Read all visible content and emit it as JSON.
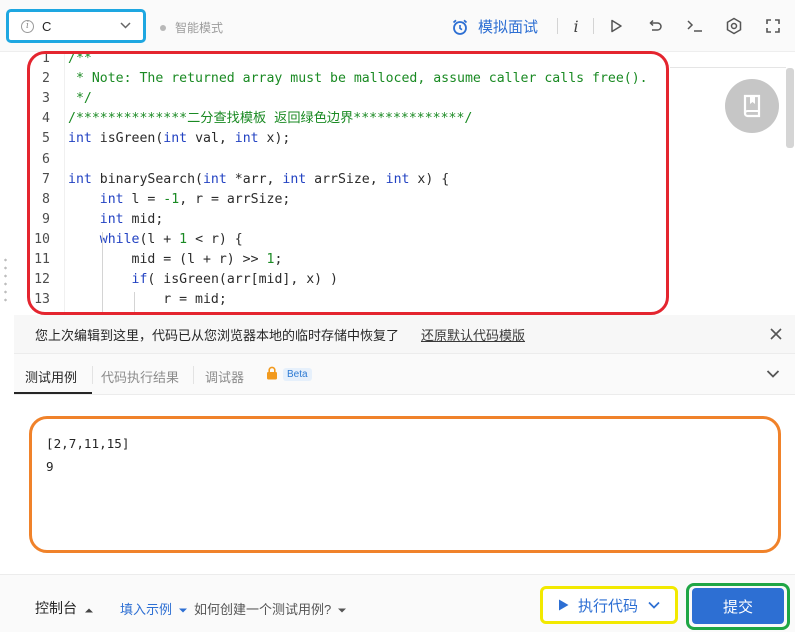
{
  "toolbar": {
    "language": "C",
    "smart_mode": "智能模式",
    "mock_interview": "模拟面试",
    "icons": [
      "info-icon",
      "run-triangle-icon",
      "reset-icon",
      "terminal-icon",
      "settings-icon",
      "fullscreen-icon"
    ]
  },
  "editor": {
    "lines": [
      {
        "n": "1",
        "text": "/**"
      },
      {
        "n": "2",
        "text": " * Note: The returned array must be malloced, assume caller calls free()."
      },
      {
        "n": "3",
        "text": " */"
      },
      {
        "n": "4",
        "text": "/**************二分查找模板 返回绿色边界**************/"
      },
      {
        "n": "5",
        "text": "int isGreen(int val, int x);"
      },
      {
        "n": "6",
        "text": ""
      },
      {
        "n": "7",
        "text": "int binarySearch(int *arr, int arrSize, int x) {"
      },
      {
        "n": "8",
        "text": "    int l = -1, r = arrSize;"
      },
      {
        "n": "9",
        "text": "    int mid;"
      },
      {
        "n": "10",
        "text": "    while(l + 1 < r) {"
      },
      {
        "n": "11",
        "text": "        mid = (l + r) >> 1;"
      },
      {
        "n": "12",
        "text": "        if( isGreen(arr[mid], x) )"
      },
      {
        "n": "13",
        "text": "            r = mid;"
      }
    ]
  },
  "restore": {
    "message": "您上次编辑到这里，代码已从您浏览器本地的临时存储中恢复了",
    "link": "还原默认代码模版"
  },
  "tabs": {
    "items": [
      "测试用例",
      "代码执行结果",
      "调试器"
    ],
    "beta": "Beta"
  },
  "testcase": {
    "lines": [
      "[2,7,11,15]",
      "9"
    ]
  },
  "bottom": {
    "console": "控制台",
    "fill_example": "填入示例",
    "how_create": "如何创建一个测试用例?",
    "run": "执行代码",
    "submit": "提交"
  },
  "colors": {
    "accent": "#2d6fd3",
    "annotation_blue": "#1ea7e1",
    "annotation_red": "#e4252f",
    "annotation_orange": "#f0822a",
    "annotation_yellow": "#f2e900",
    "annotation_green": "#1fa645"
  }
}
